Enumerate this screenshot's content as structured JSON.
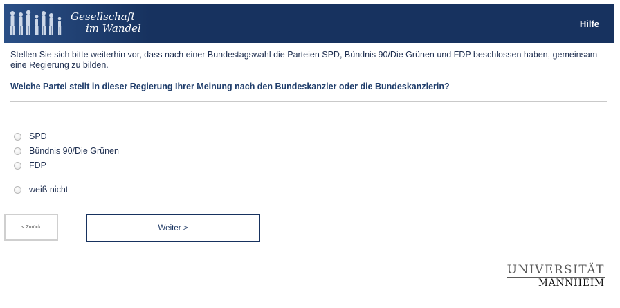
{
  "header": {
    "logo_line1": "Gesellschaft",
    "logo_line2": "im Wandel",
    "help_label": "Hilfe"
  },
  "survey": {
    "intro": "Stellen Sie sich bitte weiterhin vor, dass nach einer Bundestagswahl die Parteien SPD, Bündnis 90/Die Grünen und FDP beschlossen haben, gemeinsam eine Regierung zu bilden.",
    "question": "Welche Partei stellt in dieser Regierung Ihrer Meinung nach den Bundeskanzler oder die Bundeskanzlerin?",
    "options": [
      "SPD",
      "Bündnis 90/Die Grünen",
      "FDP",
      "weiß nicht"
    ]
  },
  "nav": {
    "back_label": "< Zurück",
    "next_label": "Weiter >"
  },
  "footer": {
    "uni_line1": "UNIVERSITÄT",
    "uni_line2": "MANNHEIM"
  },
  "colors": {
    "brand": "#17325f",
    "text": "#1f2f50"
  }
}
